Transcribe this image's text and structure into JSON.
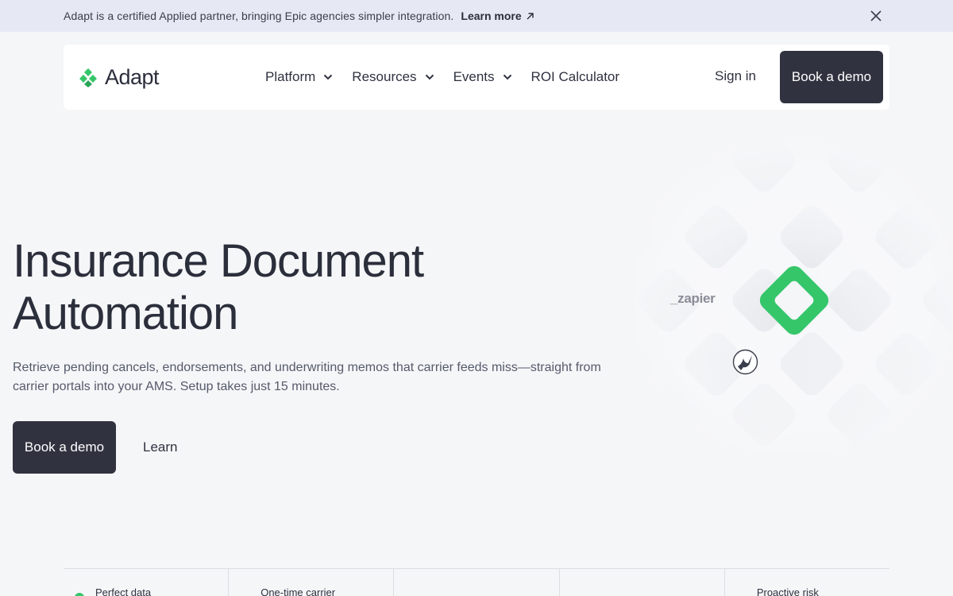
{
  "announcement": {
    "message": "Adapt is a certified Applied partner, bringing Epic agencies simpler integration.",
    "link_label": "Learn more",
    "link_icon": "arrow-up-right-icon",
    "close_icon": "close-icon"
  },
  "nav": {
    "brand": "Adapt",
    "items": [
      {
        "label": "Platform",
        "dropdown": true
      },
      {
        "label": "Resources",
        "dropdown": true
      },
      {
        "label": "Events",
        "dropdown": true
      },
      {
        "label": "ROI Calculator",
        "dropdown": false
      }
    ],
    "sign_in": "Sign in",
    "cta": "Book a demo"
  },
  "hero": {
    "title_line1": "Insurance Document",
    "title_line2": "Automation",
    "subtitle": "Retrieve pending cancels, endorsements, and underwriting memos that carrier feeds miss—straight from carrier portals into your AMS. Setup takes just 15 minutes.",
    "cta_primary": "Book a demo",
    "cta_secondary": "Learn"
  },
  "integrations": {
    "zapier": "_zapier",
    "accent": "#35c66a"
  },
  "features": [
    {
      "label": "Perfect data"
    },
    {
      "label": "One-time carrier"
    },
    {
      "label": ""
    },
    {
      "label": ""
    },
    {
      "label": "Proactive risk"
    }
  ],
  "colors": {
    "brand_green": "#35c66a",
    "dark_button": "#30323f",
    "announcement_bg": "#e6e9f3"
  }
}
